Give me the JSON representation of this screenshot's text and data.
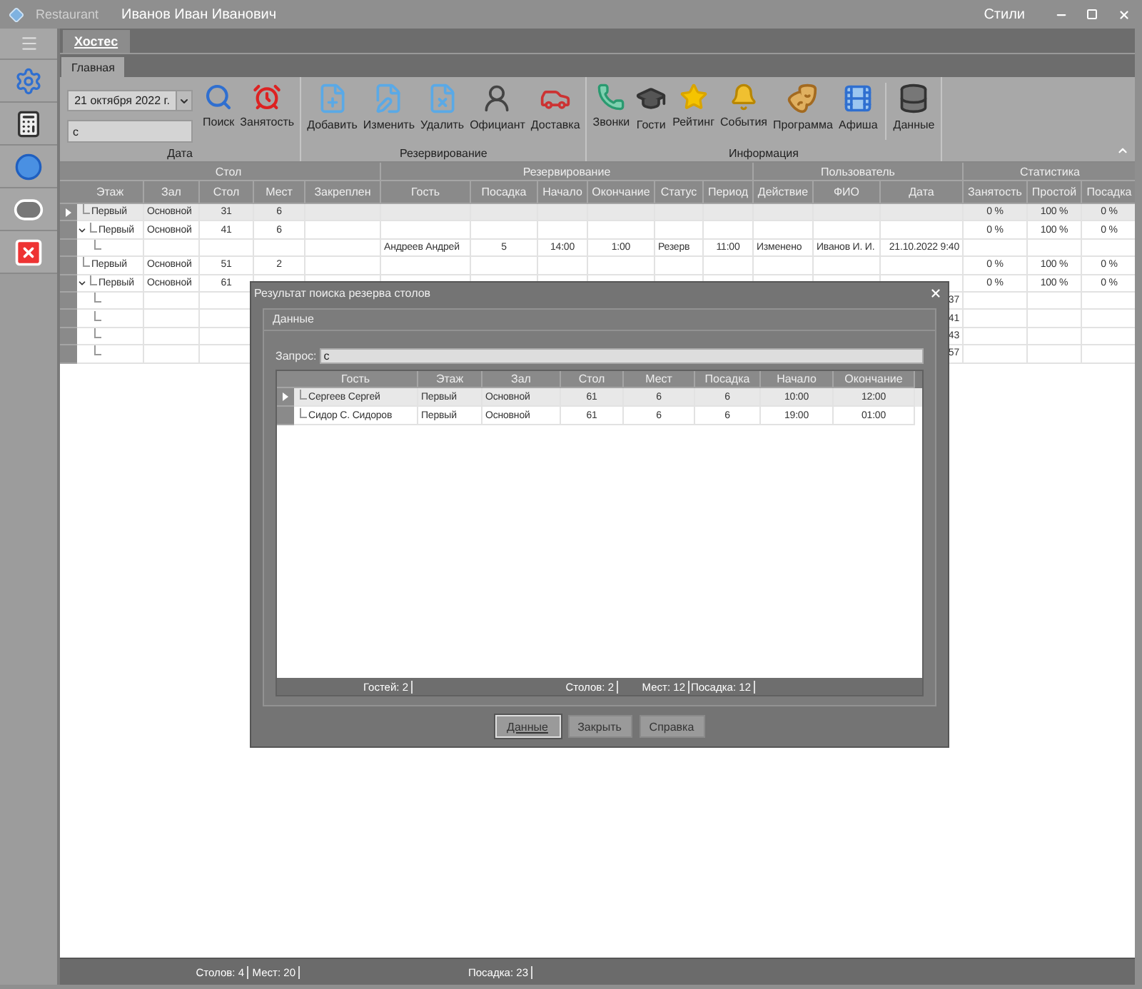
{
  "window": {
    "app_name": "Restaurant",
    "user": "Иванов Иван Иванович",
    "styles_menu": "Стили"
  },
  "page_tabs": [
    {
      "label": "Хостес",
      "selected": true
    }
  ],
  "ribbon_tabs": [
    {
      "label": "Главная",
      "selected": true
    }
  ],
  "ribbon": {
    "date": "21 октября 2022 г.",
    "search_value": "с",
    "groups": [
      {
        "label": "Дата",
        "buttons": [
          "Поиск",
          "Занятость"
        ]
      },
      {
        "label": "Резервирование",
        "buttons": [
          "Добавить",
          "Изменить",
          "Удалить",
          "Официант",
          "Доставка"
        ]
      },
      {
        "label": "Информация",
        "buttons": [
          "Звонки",
          "Гости",
          "Рейтинг",
          "События",
          "Программа",
          "Афиша"
        ],
        "extra_buttons": [
          "Данные"
        ]
      }
    ]
  },
  "grid": {
    "column_groups": [
      {
        "label": "Стол",
        "columns": [
          "Этаж",
          "Зал",
          "Стол",
          "Мест",
          "Закреплен"
        ]
      },
      {
        "label": "Резервирование",
        "columns": [
          "Гость",
          "Посадка",
          "Начало",
          "Окончание",
          "Статус",
          "Период"
        ]
      },
      {
        "label": "Пользователь",
        "columns": [
          "Действие",
          "ФИО",
          "Дата"
        ]
      },
      {
        "label": "Статистика",
        "columns": [
          "Занятость",
          "Простой",
          "Посадка"
        ]
      }
    ],
    "rows": [
      {
        "selected": true,
        "cells": {
          "floor": "Первый",
          "hall": "Основной",
          "table": "31",
          "seats": "6",
          "occupancy": "0 %",
          "idle": "100 %",
          "seated": "0 %"
        }
      },
      {
        "selected": false,
        "expanded": true,
        "cells": {
          "floor": "Первый",
          "hall": "Основной",
          "table": "41",
          "seats": "6",
          "occupancy": "0 %",
          "idle": "100 %",
          "seated": "0 %"
        },
        "children": [
          {
            "selected": false,
            "cells": {
              "guest": "Андреев Андрей",
              "seating": "5",
              "start": "14:00",
              "end": "1:00",
              "status": "Резерв",
              "period": "11:00",
              "action": "Изменено",
              "user": "Иванов И. И.",
              "date": "21.10.2022 9:40"
            }
          }
        ]
      },
      {
        "selected": false,
        "cells": {
          "floor": "Первый",
          "hall": "Основной",
          "table": "51",
          "seats": "2",
          "occupancy": "0 %",
          "idle": "100 %",
          "seated": "0 %"
        }
      },
      {
        "selected": false,
        "expanded": true,
        "cells": {
          "floor": "Первый",
          "hall": "Основной",
          "table": "61",
          "occupancy": "0 %",
          "idle": "100 %",
          "seated": "0 %"
        },
        "children": [
          {
            "selected": false,
            "cells": {
              "date": "37"
            }
          },
          {
            "selected": false,
            "cells": {
              "date": "41"
            }
          },
          {
            "selected": false,
            "cells": {
              "date": "43"
            }
          },
          {
            "selected": false,
            "cells": {
              "date": "57"
            }
          }
        ]
      }
    ],
    "status": {
      "tables": "Столов: 4",
      "seats": "Мест: 20",
      "seated": "Посадка: 23"
    }
  },
  "dialog": {
    "title": "Результат поиска резерва столов",
    "panel_title": "Данные",
    "query_label": "Запрос:",
    "query": "с",
    "columns": [
      "Гость",
      "Этаж",
      "Зал",
      "Стол",
      "Мест",
      "Посадка",
      "Начало",
      "Окончание"
    ],
    "rows": [
      {
        "selected": true,
        "cells": [
          "Сергеев Сергей",
          "Первый",
          "Основной",
          "61",
          "6",
          "6",
          "10:00",
          "12:00"
        ]
      },
      {
        "selected": false,
        "cells": [
          "Сидор С. Сидоров",
          "Первый",
          "Основной",
          "61",
          "6",
          "6",
          "19:00",
          "01:00"
        ]
      }
    ],
    "footer": {
      "guests": "Гостей: 2",
      "tables": "Столов: 2",
      "seats": "Мест: 12",
      "seated": "Посадка: 12"
    },
    "buttons": [
      {
        "label": "Данные",
        "default": true
      },
      {
        "label": "Закрыть",
        "default": false
      },
      {
        "label": "Справка",
        "default": false
      }
    ]
  }
}
